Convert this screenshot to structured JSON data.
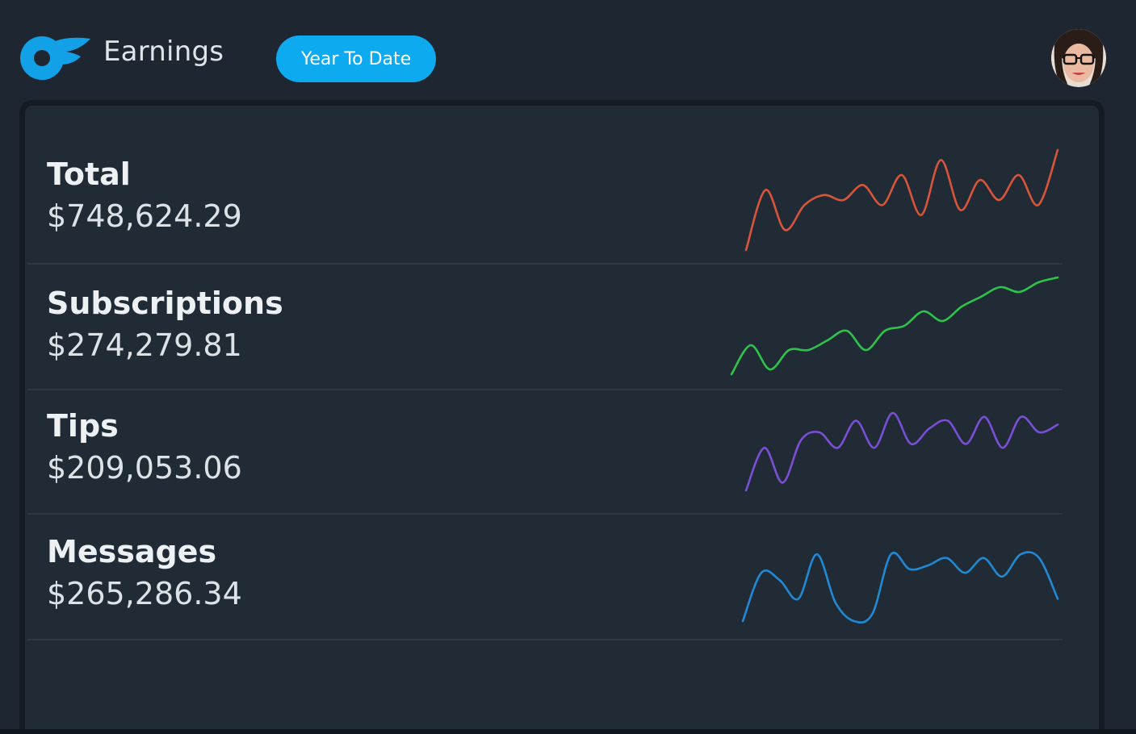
{
  "header": {
    "title": "Earnings",
    "range_button": "Year To Date",
    "logo_icon": "onlyfans-logo-icon",
    "avatar_icon": "user-avatar"
  },
  "colors": {
    "accent": "#0eaaf0",
    "total": "#d9553a",
    "subscriptions": "#2fc34a",
    "tips": "#7a4fd6",
    "messages": "#2189d4"
  },
  "rows": [
    {
      "label": "Total",
      "value": "$748,624.29"
    },
    {
      "label": "Subscriptions",
      "value": "$274,279.81"
    },
    {
      "label": "Tips",
      "value": "$209,053.06"
    },
    {
      "label": "Messages",
      "value": "$265,286.34"
    }
  ],
  "chart_data": [
    {
      "type": "line",
      "series": [
        {
          "values": [
            0.0,
            0.6,
            0.2,
            0.45,
            0.55,
            0.5,
            0.65,
            0.45,
            0.75,
            0.35,
            0.9,
            0.4,
            0.7,
            0.5,
            0.75,
            0.45,
            1.0
          ]
        }
      ]
    },
    {
      "type": "line",
      "series": [
        {
          "values": [
            0.0,
            0.3,
            0.05,
            0.25,
            0.25,
            0.35,
            0.45,
            0.25,
            0.45,
            0.5,
            0.65,
            0.55,
            0.7,
            0.8,
            0.9,
            0.85,
            0.95,
            1.0
          ]
        }
      ]
    },
    {
      "type": "line",
      "series": [
        {
          "values": [
            0.0,
            0.55,
            0.1,
            0.65,
            0.75,
            0.55,
            0.9,
            0.55,
            1.0,
            0.6,
            0.8,
            0.9,
            0.6,
            0.95,
            0.55,
            0.95,
            0.75,
            0.85
          ]
        }
      ]
    },
    {
      "type": "line",
      "series": [
        {
          "values": [
            0.0,
            0.65,
            0.55,
            0.3,
            0.9,
            0.25,
            0.0,
            0.1,
            0.9,
            0.7,
            0.75,
            0.85,
            0.65,
            0.85,
            0.6,
            0.9,
            0.85,
            0.3
          ]
        }
      ]
    }
  ]
}
